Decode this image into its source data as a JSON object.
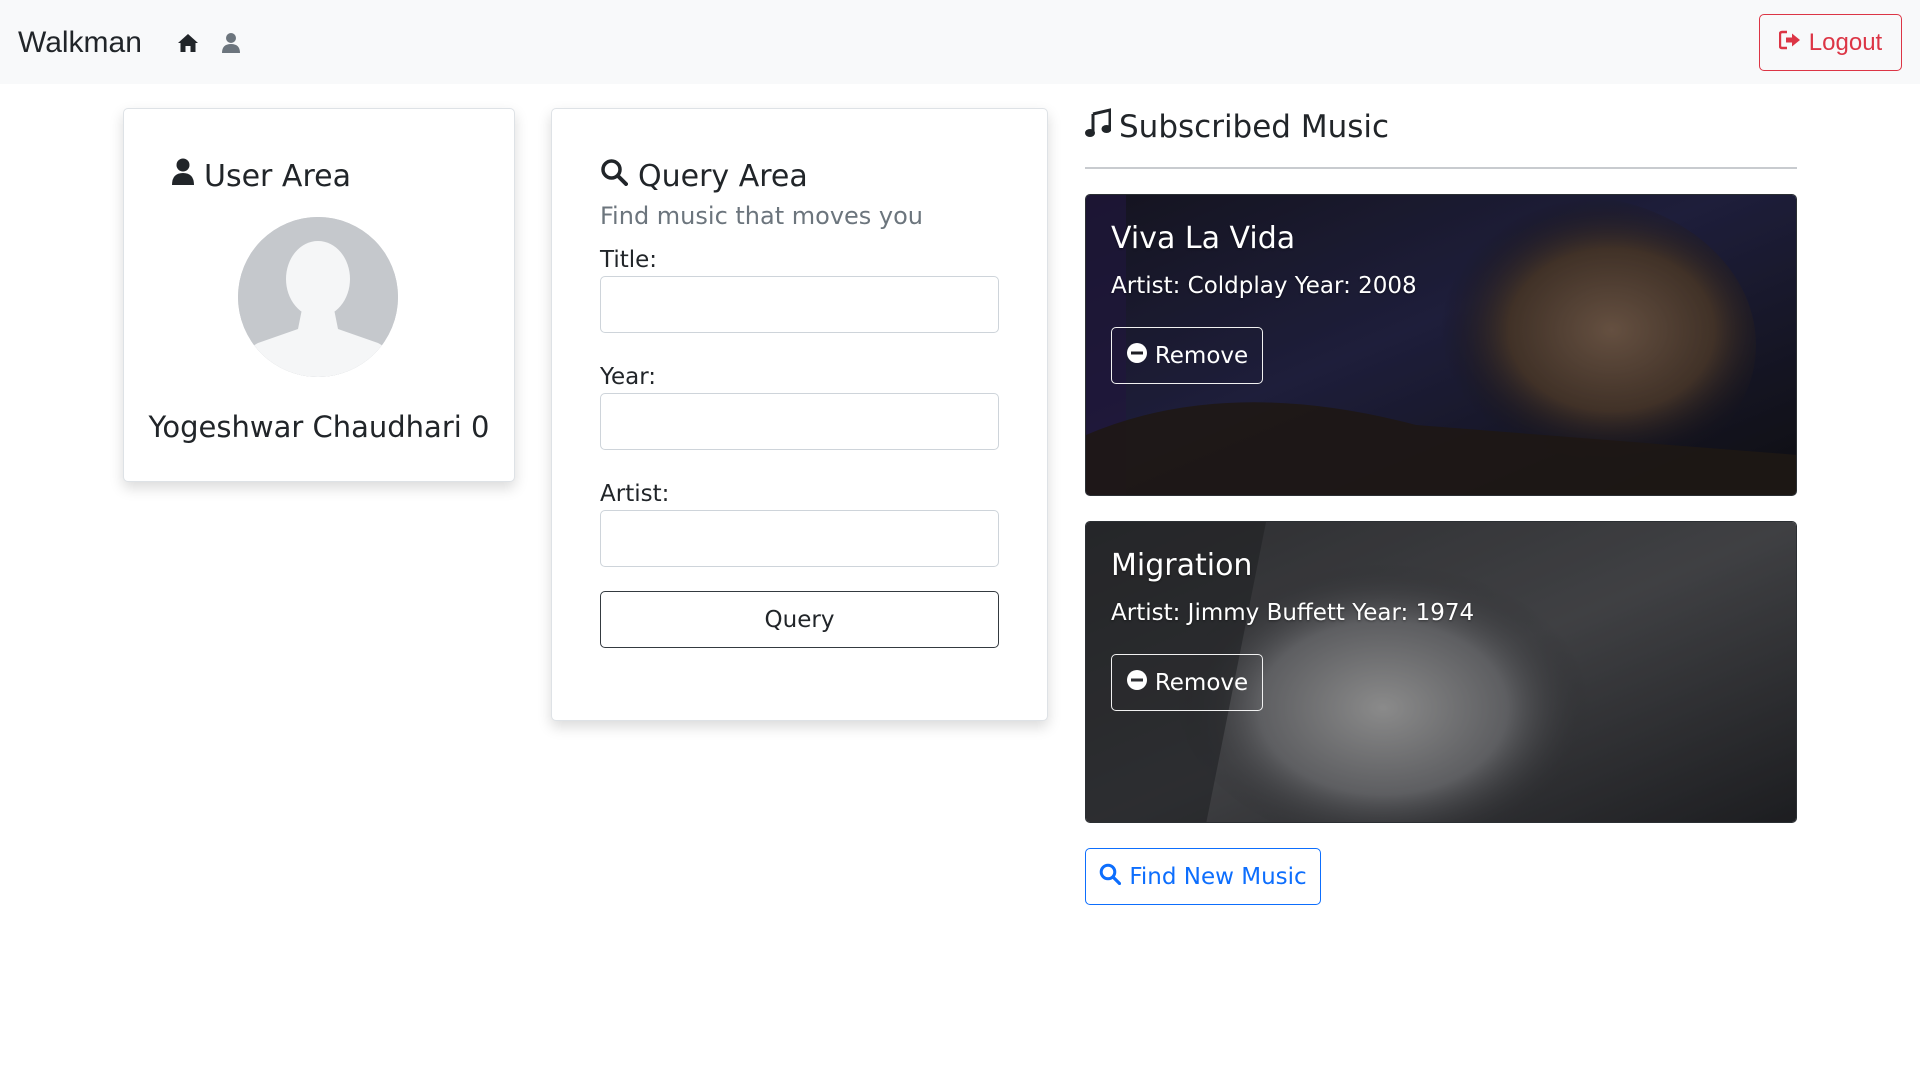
{
  "navbar": {
    "brand": "Walkman",
    "home_icon": "home-icon",
    "profile_icon": "user-icon",
    "logout_label": "Logout",
    "logout_icon": "sign-out-icon"
  },
  "user_area": {
    "title": "User Area",
    "title_icon": "user-icon",
    "avatar_icon": "avatar-silhouette-icon",
    "user_name": "Yogeshwar Chaudhari 0"
  },
  "query_area": {
    "title": "Query Area",
    "title_icon": "search-icon",
    "subtitle": "Find music that moves you",
    "fields": [
      {
        "label": "Title:",
        "value": ""
      },
      {
        "label": "Year:",
        "value": ""
      },
      {
        "label": "Artist:",
        "value": ""
      }
    ],
    "submit_label": "Query"
  },
  "subscribed": {
    "title": "Subscribed Music",
    "title_icon": "music-note-icon",
    "items": [
      {
        "title": "Viva La Vida",
        "meta": "Artist: Coldplay Year: 2008",
        "remove_label": "Remove"
      },
      {
        "title": "Migration",
        "meta": "Artist: Jimmy Buffett Year: 1974",
        "remove_label": "Remove"
      }
    ],
    "find_label": "Find New Music",
    "find_icon": "search-icon"
  },
  "colors": {
    "navbar_bg": "#f8f9fa",
    "danger": "#dc3545",
    "primary": "#0d6efd",
    "muted": "#6c757d"
  }
}
